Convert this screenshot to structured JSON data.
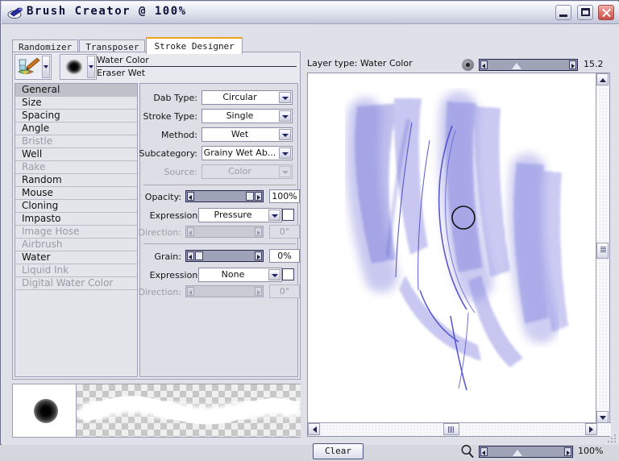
{
  "window": {
    "title": "Brush Creator @ 100%",
    "icon": "brush-cup-icon",
    "buttons": {
      "minimize": "Minimize",
      "maximize": "Maximize",
      "close": "Close"
    }
  },
  "tabs": [
    {
      "label": "Randomizer",
      "active": false
    },
    {
      "label": "Transposer",
      "active": false
    },
    {
      "label": "Stroke Designer",
      "active": true
    }
  ],
  "brush": {
    "category_icon": "brush-category-icon",
    "variant_icon": "brush-dab-icon",
    "category_name": "Water Color",
    "variant_name": "Eraser Wet"
  },
  "categories": [
    {
      "label": "General",
      "selected": true,
      "disabled": false
    },
    {
      "label": "Size",
      "selected": false,
      "disabled": false
    },
    {
      "label": "Spacing",
      "selected": false,
      "disabled": false
    },
    {
      "label": "Angle",
      "selected": false,
      "disabled": false
    },
    {
      "label": "Bristle",
      "selected": false,
      "disabled": true
    },
    {
      "label": "Well",
      "selected": false,
      "disabled": false
    },
    {
      "label": "Rake",
      "selected": false,
      "disabled": true
    },
    {
      "label": "Random",
      "selected": false,
      "disabled": false
    },
    {
      "label": "Mouse",
      "selected": false,
      "disabled": false
    },
    {
      "label": "Cloning",
      "selected": false,
      "disabled": false
    },
    {
      "label": "Impasto",
      "selected": false,
      "disabled": false
    },
    {
      "label": "Image Hose",
      "selected": false,
      "disabled": true
    },
    {
      "label": "Airbrush",
      "selected": false,
      "disabled": true
    },
    {
      "label": "Water",
      "selected": false,
      "disabled": false
    },
    {
      "label": "Liquid Ink",
      "selected": false,
      "disabled": true
    },
    {
      "label": "Digital Water Color",
      "selected": false,
      "disabled": true
    }
  ],
  "general": {
    "dab_type": {
      "label": "Dab Type:",
      "value": "Circular"
    },
    "stroke_type": {
      "label": "Stroke Type:",
      "value": "Single"
    },
    "method": {
      "label": "Method:",
      "value": "Wet"
    },
    "subcategory": {
      "label": "Subcategory:",
      "value": "Grainy Wet Ab..."
    },
    "source": {
      "label": "Source:",
      "value": "Color"
    },
    "opacity": {
      "label": "Opacity:",
      "value": "100%",
      "percent": 100,
      "expression_label": "Expression:",
      "expression_value": "Pressure",
      "direction_label": "Direction:",
      "direction_value": "0°"
    },
    "grain": {
      "label": "Grain:",
      "value": "0%",
      "percent": 0,
      "expression_label": "Expression:",
      "expression_value": "None",
      "direction_label": "Direction:",
      "direction_value": "0°"
    }
  },
  "canvas": {
    "layer_type_label": "Layer type: Water Color",
    "brush_size_value": "15.2",
    "brush_size_percent": 37,
    "zoom_value": "100%",
    "zoom_percent": 40,
    "clear_button": "Clear",
    "magnifier_icon": "magnifier-icon",
    "stroke_color": "#4a48c8"
  }
}
